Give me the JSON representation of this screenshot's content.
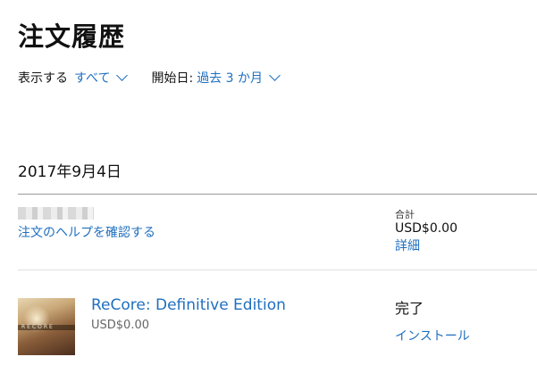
{
  "page_title": "注文履歴",
  "filters": {
    "show_label": "表示する",
    "show_value": "すべて",
    "start_label": "開始日:",
    "start_value": "過去 3 か月"
  },
  "order": {
    "date": "2017年9月4日",
    "help_link": "注文のヘルプを確認する",
    "total_label": "合計",
    "total_value": "USD$0.00",
    "details_link": "詳細",
    "items": [
      {
        "thumbnail_text": "RECORE",
        "name": "ReCore: Definitive Edition",
        "price": "USD$0.00",
        "status": "完了",
        "action": "インストール"
      }
    ]
  },
  "colors": {
    "link": "#1f6fbf",
    "text": "#111111",
    "rule": "#999999"
  }
}
